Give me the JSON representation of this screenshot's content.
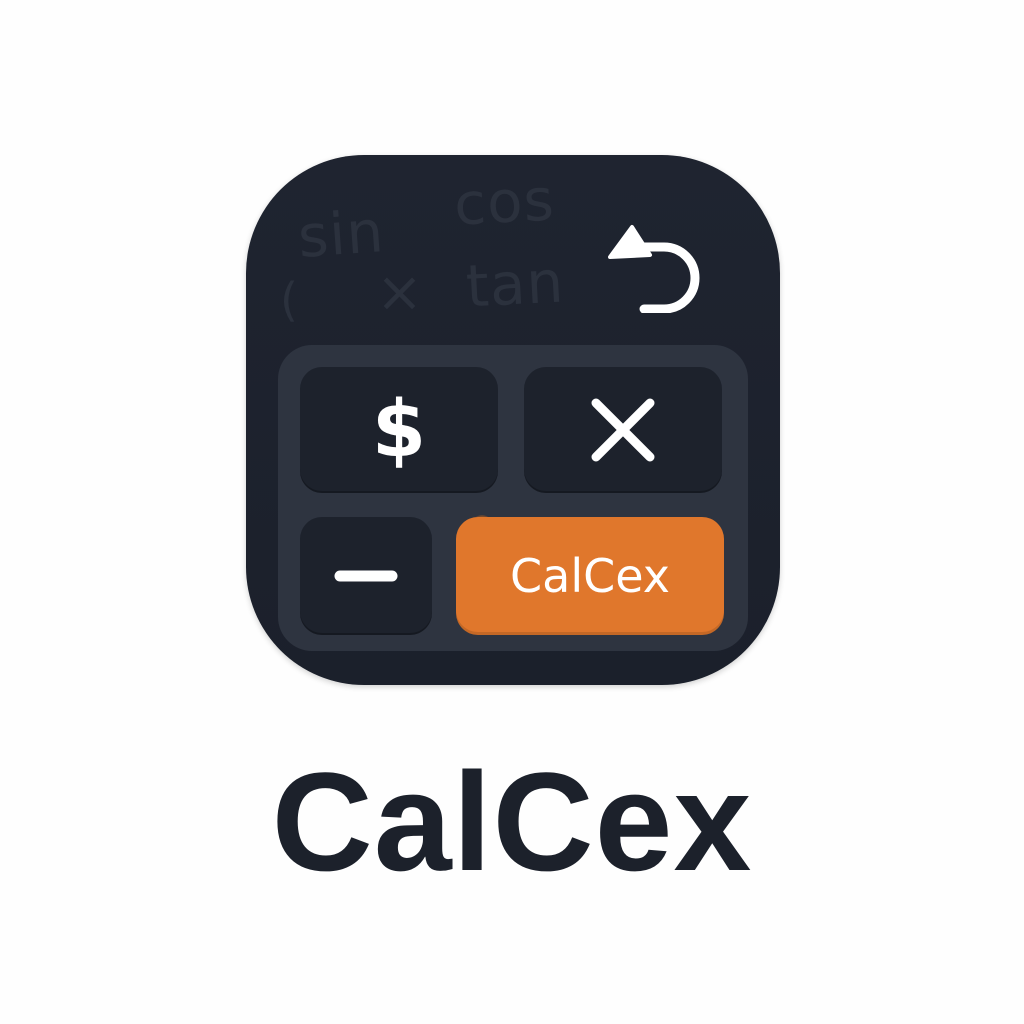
{
  "app": {
    "name": "CalCex",
    "wordmark": "CalCex"
  },
  "icon": {
    "background_labels": {
      "sin": "sin",
      "cos": "cos",
      "times": "×",
      "tan": "tan",
      "paren": "("
    },
    "keys": {
      "dollar": "$",
      "times_icon": "close-x-icon",
      "minus_icon": "minus-icon",
      "brand": "CalCex"
    },
    "undo_icon": "undo-icon"
  },
  "colors": {
    "icon_background": "#1f2430",
    "keypad_panel": "#2e3440",
    "key": "#1d222c",
    "brand_accent": "#e0772c",
    "wordmark": "#1c212b",
    "page_background": "#fefefe"
  }
}
